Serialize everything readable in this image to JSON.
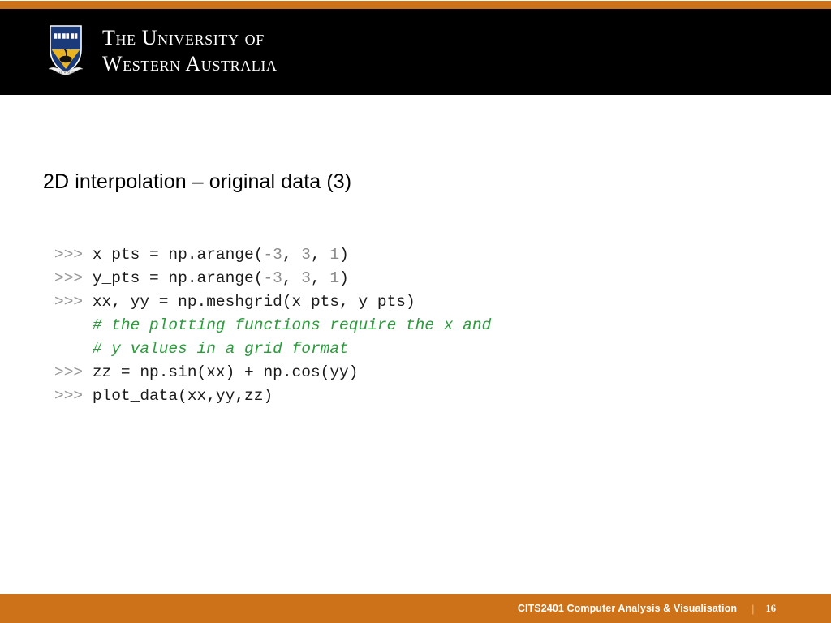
{
  "slide": {
    "title": "2D interpolation – original data (3)",
    "colors": {
      "accent_orange": "#ce7219",
      "header_black": "#000000",
      "background": "#ffffff",
      "comment_green": "#2d9a3e",
      "prompt_gray": "#999999",
      "number_gray": "#8c8c8c"
    }
  },
  "branding": {
    "crest_icon": "uwa-crest-icon",
    "wordmark_line1": "The University of",
    "wordmark_line2": "Western Australia"
  },
  "code": {
    "lines": [
      {
        "prompt": ">>> ",
        "segments": [
          {
            "type": "code",
            "text": "x_pts = np.arange("
          },
          {
            "type": "num",
            "text": "-3"
          },
          {
            "type": "code",
            "text": ", "
          },
          {
            "type": "num",
            "text": "3"
          },
          {
            "type": "code",
            "text": ", "
          },
          {
            "type": "num",
            "text": "1"
          },
          {
            "type": "code",
            "text": ")"
          }
        ]
      },
      {
        "prompt": ">>> ",
        "segments": [
          {
            "type": "code",
            "text": "y_pts = np.arange("
          },
          {
            "type": "num",
            "text": "-3"
          },
          {
            "type": "code",
            "text": ", "
          },
          {
            "type": "num",
            "text": "3"
          },
          {
            "type": "code",
            "text": ", "
          },
          {
            "type": "num",
            "text": "1"
          },
          {
            "type": "code",
            "text": ")"
          }
        ]
      },
      {
        "prompt": ">>> ",
        "segments": [
          {
            "type": "code",
            "text": "xx, yy = np.meshgrid(x_pts, y_pts)"
          }
        ]
      },
      {
        "prompt": "    ",
        "segments": [
          {
            "type": "comment",
            "text": "# the plotting functions require the x and"
          }
        ]
      },
      {
        "prompt": "    ",
        "segments": [
          {
            "type": "comment",
            "text": "# y values in a grid format"
          }
        ]
      },
      {
        "prompt": ">>> ",
        "segments": [
          {
            "type": "code",
            "text": "zz = np.sin(xx) + np.cos(yy)"
          }
        ]
      },
      {
        "prompt": ">>> ",
        "segments": [
          {
            "type": "code",
            "text": "plot_data(xx,yy,zz)"
          }
        ]
      }
    ]
  },
  "footer": {
    "course": "CITS2401 Computer Analysis & Visualisation",
    "separator": "|",
    "page_number": "16"
  }
}
